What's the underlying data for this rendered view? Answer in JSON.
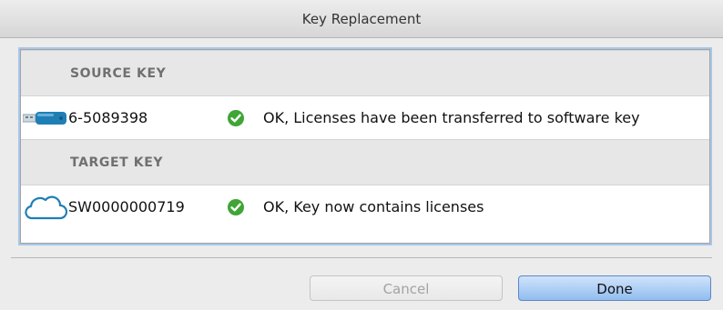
{
  "window": {
    "title": "Key Replacement"
  },
  "sections": [
    {
      "header": "SOURCE KEY",
      "key_icon": "usb-key-icon",
      "key_id": "6-5089398",
      "status_icon": "check-circle-icon",
      "status_text": "OK, Licenses have been transferred to software key"
    },
    {
      "header": "TARGET KEY",
      "key_icon": "cloud-icon",
      "key_id": "SW0000000719",
      "status_icon": "check-circle-icon",
      "status_text": "OK, Key now contains licenses"
    }
  ],
  "buttons": {
    "cancel_label": "Cancel",
    "done_label": "Done"
  },
  "colors": {
    "status_ok": "#3fa535",
    "icon_blue": "#1f7fb5",
    "default_button": "#92bdf0"
  }
}
